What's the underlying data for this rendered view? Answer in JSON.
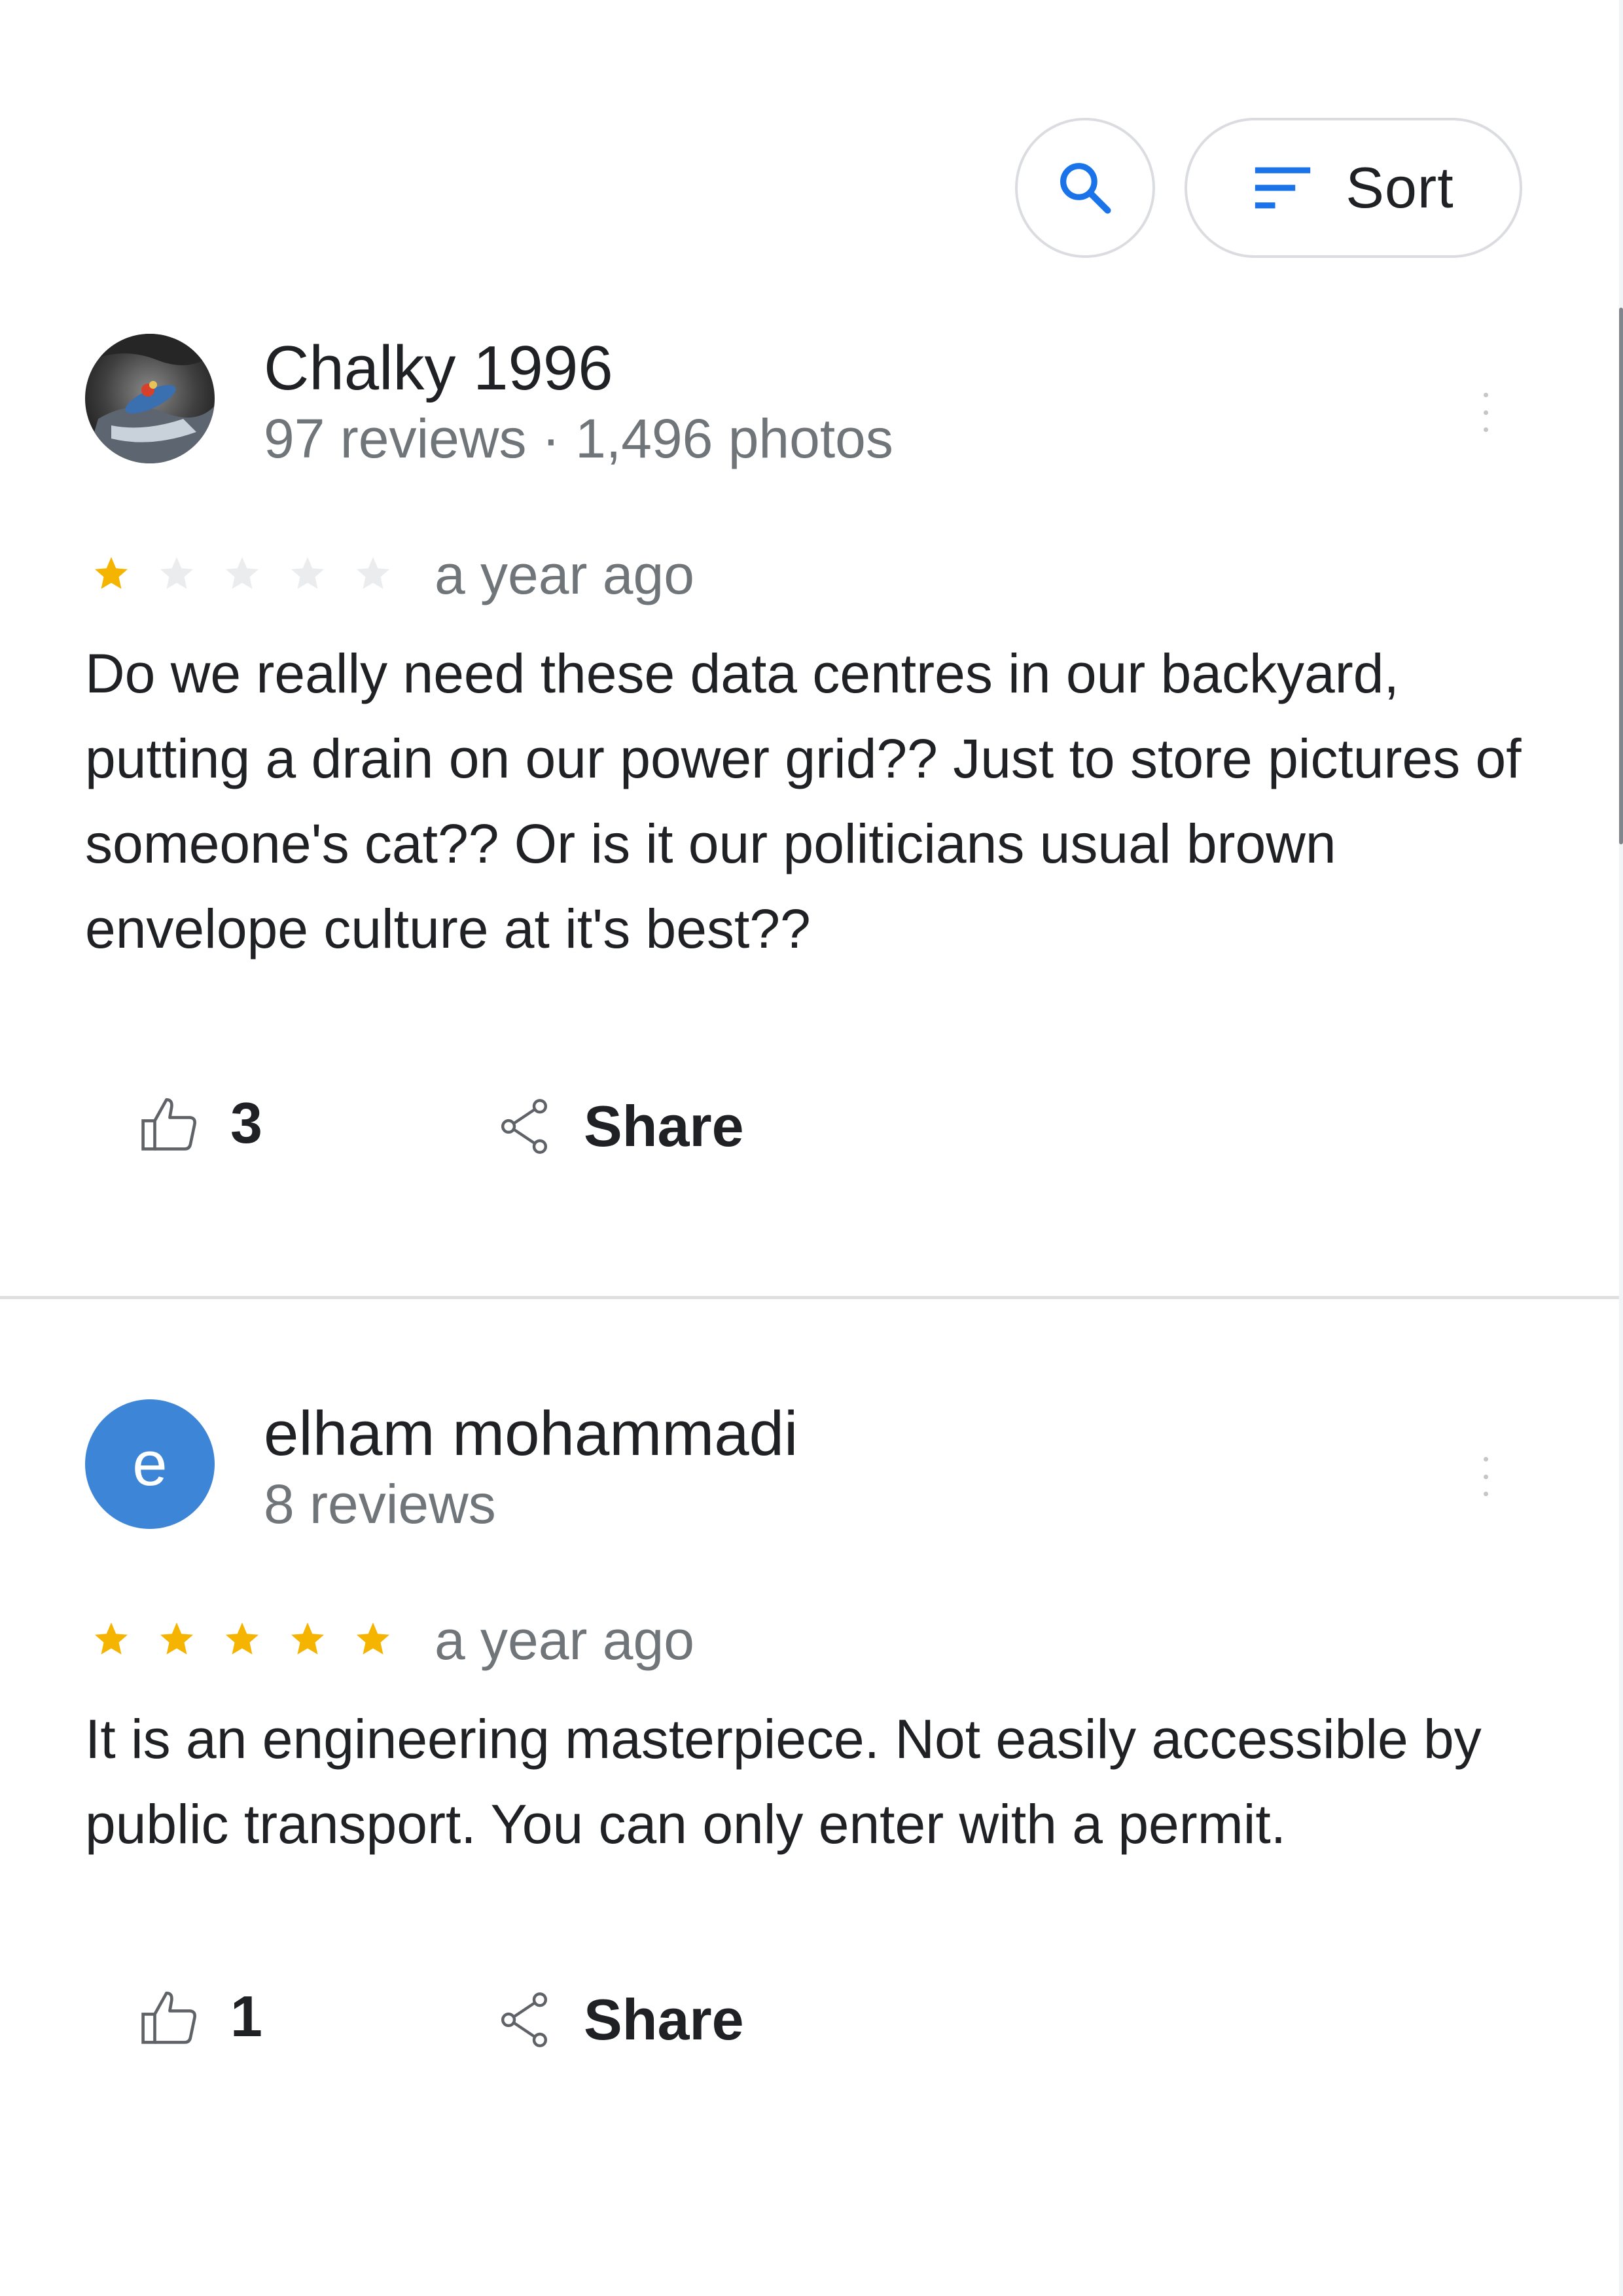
{
  "toolbar": {
    "search_icon": "search-icon",
    "sort_icon": "sort-lines-icon",
    "sort_label": "Sort",
    "accent_color": "#1a73e8"
  },
  "reviews": [
    {
      "author": "Chalky 1996",
      "meta": "97 reviews · 1,496 photos",
      "avatar": "photo",
      "rating": 1,
      "time": "a year ago",
      "text": "Do we really need these data centres in our backyard, putting a drain on our power grid?? Just to store pictures of someone's cat?? Or is it our politicians usual brown envelope culture at it's best??",
      "likes": "3",
      "share_label": "Share"
    },
    {
      "author": "elham mohammadi",
      "meta": "8 reviews",
      "avatar": "e",
      "avatar_color": "#3d85d6",
      "rating": 5,
      "time": "a year ago",
      "text": "It is an engineering masterpiece. Not easily accessible by public transport. You can only enter with a permit.",
      "likes": "1",
      "share_label": "Share"
    }
  ],
  "colors": {
    "star_filled": "#f5b400",
    "star_empty": "#e8eaed"
  }
}
